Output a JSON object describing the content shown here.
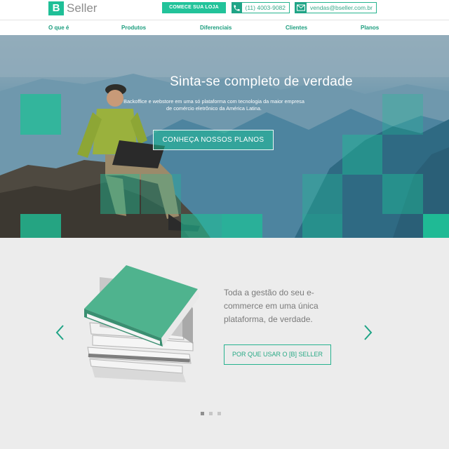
{
  "header": {
    "logo_mark": "B",
    "logo_text": "Seller",
    "cta_label": "COMECE SUA LOJA",
    "phone": "(11) 4003-9082",
    "email": "vendas@bseller.com.br",
    "phone_icon": "phone-icon",
    "email_icon": "envelope-icon"
  },
  "nav": {
    "items": [
      {
        "label": "O que é"
      },
      {
        "label": "Produtos"
      },
      {
        "label": "Diferenciais"
      },
      {
        "label": "Clientes"
      },
      {
        "label": "Planos"
      }
    ]
  },
  "hero": {
    "title": "Sinta-se completo de verdade",
    "subtitle": "Backoffice e webstore em uma só plataforma com tecnologia da maior empresa de comércio eletrônico da América Latina.",
    "button_label": "CONHEÇA NOSSOS PLANOS"
  },
  "feature": {
    "text": "Toda a gestão do seu e-commerce em uma única plataforma, de verdade.",
    "button_label": "POR QUE USAR O [B] SELLER",
    "prev_icon": "chevron-left-icon",
    "next_icon": "chevron-right-icon",
    "slides_total": 3,
    "slide_active": 1
  },
  "colors": {
    "accent": "#1fbf97",
    "accent_dark": "#1fa486",
    "nav_text": "#1c9d7e",
    "body_text": "#7b7b7b"
  }
}
